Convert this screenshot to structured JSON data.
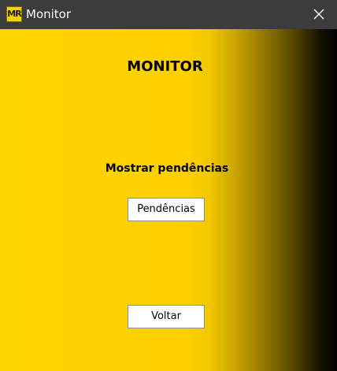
{
  "window": {
    "title": "Monitor",
    "icon_text": "MR",
    "icon_name": "app-logo-icon",
    "close_icon": "close-icon"
  },
  "main": {
    "heading": "MONITOR",
    "subheading": "Mostrar pendências",
    "pendencias_button": "Pendências",
    "voltar_button": "Voltar"
  },
  "colors": {
    "titlebar": "#3c3c3c",
    "background_start": "#ffd400",
    "background_end": "#000000",
    "button_background": "#ffffff"
  }
}
